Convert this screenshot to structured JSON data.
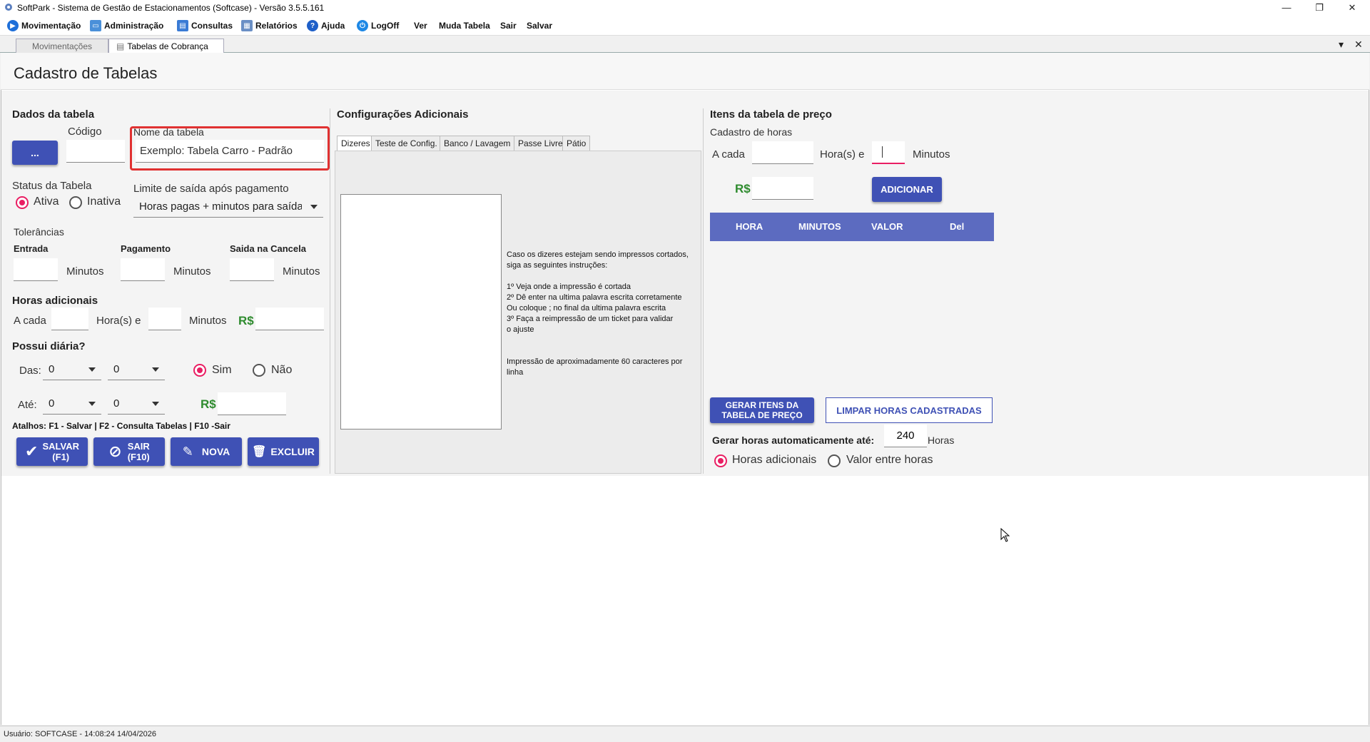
{
  "window": {
    "title": "SoftPark - Sistema de Gestão de Estacionamentos (Softcase) - Versão 3.5.5.161",
    "minimize": "—",
    "restore": "❐",
    "close": "✕"
  },
  "menu": {
    "items": [
      {
        "label": "Movimentação",
        "icon": "play-icon"
      },
      {
        "label": "Administração",
        "icon": "monitor-icon"
      },
      {
        "label": "Consultas",
        "icon": "consult-icon"
      },
      {
        "label": "Relatórios",
        "icon": "report-icon"
      },
      {
        "label": "Ajuda",
        "icon": "help-icon"
      },
      {
        "label": "LogOff",
        "icon": "power-icon"
      },
      {
        "label": "Ver"
      },
      {
        "label": "Muda Tabela"
      },
      {
        "label": "Sair"
      },
      {
        "label": "Salvar"
      }
    ]
  },
  "tabs": {
    "items": [
      "Movimentações",
      "Tabelas de Cobrança"
    ],
    "active": "Tabelas de Cobrança",
    "dropdown_glyph": "▾",
    "close_glyph": "✕"
  },
  "page": {
    "title": "Cadastro de Tabelas"
  },
  "dados": {
    "section": "Dados da tabela",
    "lookup_button": "...",
    "codigo_label": "Código",
    "codigo_value": "",
    "nome_label": "Nome da tabela",
    "nome_value": "Exemplo: Tabela Carro - Padrão",
    "status_label": "Status da Tabela",
    "status_options": [
      "Ativa",
      "Inativa"
    ],
    "status_selected": "Ativa",
    "limite_label": "Limite de saída após pagamento",
    "limite_value": "Horas pagas + minutos para saída",
    "tolerancias_label": "Tolerâncias",
    "tol_entrada": "Entrada",
    "tol_pagamento": "Pagamento",
    "tol_cancela": "Saida na Cancela",
    "minutos": "Minutos",
    "horas_adic_label": "Horas adicionais",
    "a_cada": "A cada",
    "horas_e": "Hora(s) e",
    "rs": "R$",
    "possui_diaria": "Possui diária?",
    "das": "Das:",
    "ate": "Até:",
    "das_h": "0",
    "das_m": "0",
    "ate_h": "0",
    "ate_m": "0",
    "sim": "Sim",
    "nao": "Não",
    "diaria_selected": "Sim",
    "atalhos": "Atalhos: F1 - Salvar | F2 - Consulta Tabelas | F10 -Sair",
    "btn_salvar": "SALVAR\n(F1)",
    "btn_sair": "SAIR\n(F10)",
    "btn_nova": "NOVA",
    "btn_excluir": "EXCLUIR"
  },
  "config": {
    "section": "Configurações Adicionais",
    "tabs": [
      "Dizeres",
      "Teste de Config.",
      "Banco / Lavagem",
      "Passe Livre",
      "Pátio"
    ],
    "active_tab": "Dizeres",
    "instr_1": "Caso os dizeres estejam sendo impressos cortados,",
    "instr_2": "siga as seguintes instruções:",
    "instr_3": "1º Veja onde a impressão é cortada",
    "instr_4": "2º Dê enter na ultima palavra escrita corretamente",
    "instr_5": "Ou coloque ; no final da ultima palavra escrita",
    "instr_6": "3º Faça a reimpressão de um ticket para validar",
    "instr_7": "o ajuste",
    "instr_8": "Impressão de aproximadamente 60 caracteres por",
    "instr_9": "linha"
  },
  "itens": {
    "section": "Itens da tabela de preço",
    "cadastro_horas": "Cadastro de horas",
    "a_cada": "A cada",
    "horas_e": "Hora(s) e",
    "minutos": "Minutos",
    "rs": "R$",
    "adicionar": "ADICIONAR",
    "col_hora": "HORA",
    "col_minutos": "MINUTOS",
    "col_valor": "VALOR",
    "col_del": "Del",
    "btn_gerar": "GERAR ITENS DA\nTABELA DE PREÇO",
    "btn_limpar": "LIMPAR HORAS CADASTRADAS",
    "gerar_auto_label": "Gerar horas automaticamente até:",
    "gerar_auto_value": "240",
    "horas": "Horas",
    "opt_adicionais": "Horas adicionais",
    "opt_entre": "Valor entre horas",
    "opt_selected": "Horas adicionais"
  },
  "status": {
    "text": "Usuário:  SOFTCASE - 14:08:24 14/04/2026"
  },
  "colors": {
    "accent": "#3f51b5",
    "table_header": "#5c6bc0",
    "radio_on": "#e91e63",
    "money_green": "#2e8b2e",
    "highlight_red": "#e03131"
  }
}
